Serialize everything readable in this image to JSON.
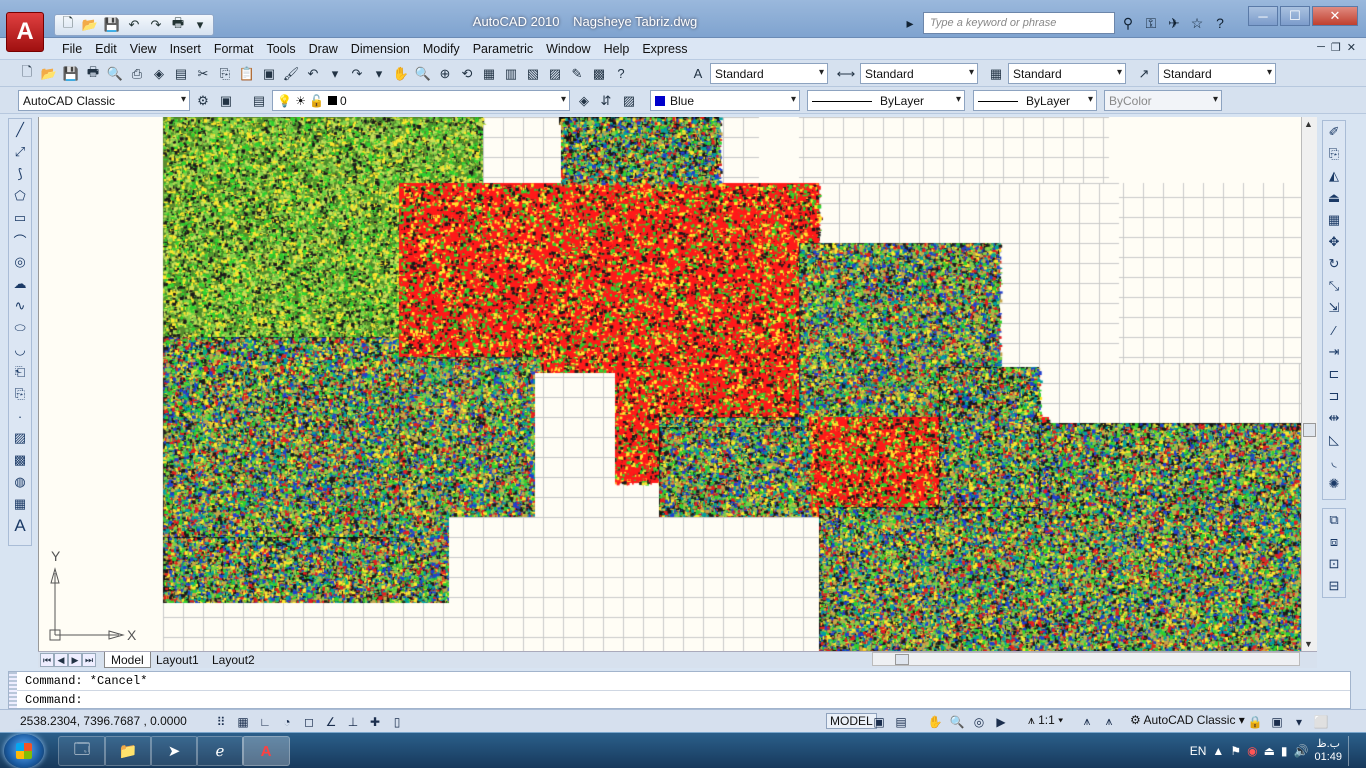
{
  "window": {
    "app_name": "AutoCAD 2010",
    "document": "Nagsheye Tabriz.dwg"
  },
  "infocenter": {
    "search_placeholder": "Type a keyword or phrase",
    "icons": [
      "binoculars-icon",
      "key-icon",
      "satellite-icon",
      "favorites-icon",
      "help-icon"
    ]
  },
  "menu": [
    "File",
    "Edit",
    "View",
    "Insert",
    "Format",
    "Tools",
    "Draw",
    "Dimension",
    "Modify",
    "Parametric",
    "Window",
    "Help",
    "Express"
  ],
  "styles_toolbar": {
    "text_style": "Standard",
    "dim_style": "Standard",
    "table_style": "Standard",
    "multileader_style": "Standard"
  },
  "workspace_combo": "AutoCAD Classic",
  "layer_combo": "0",
  "properties": {
    "color": "Blue",
    "linetype": "ByLayer",
    "lineweight": "ByLayer",
    "plotstyle": "ByColor"
  },
  "ucs": {
    "y_label": "Y",
    "x_label": "X"
  },
  "layout_tabs": [
    "Model",
    "Layout1",
    "Layout2"
  ],
  "command_lines": [
    "Command: *Cancel*",
    "Command:"
  ],
  "status": {
    "coordinates": "2538.2304, 7396.7687 , 0.0000",
    "model": "MODEL",
    "annotation_scale": "1:1",
    "workspace": "AutoCAD Classic"
  },
  "taskbar": {
    "language": "EN",
    "time": "01:49",
    "ampm": "ب.ظ",
    "apps": [
      "folder-icon",
      "explorer-icon",
      "telegram-icon",
      "ie-icon",
      "autocad-icon"
    ]
  },
  "colors": {
    "drawing_bg": "#fffdf5",
    "titlebar": "#8aadd8",
    "accent_red": "#ff1a1a"
  }
}
